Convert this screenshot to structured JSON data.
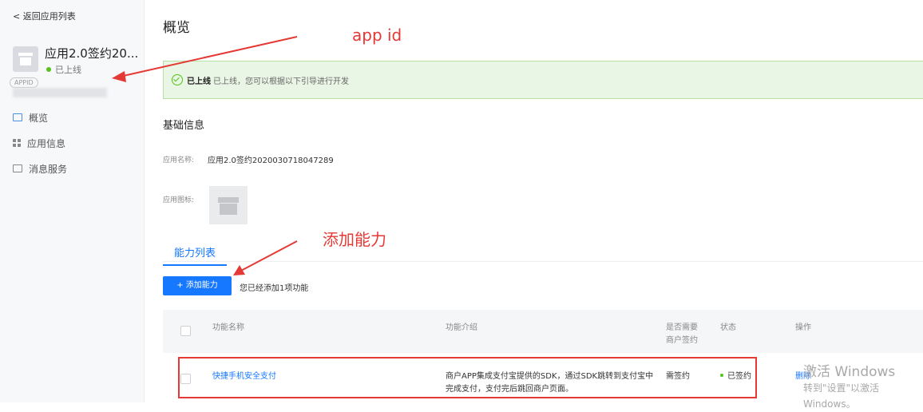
{
  "sidebar": {
    "back_label": "< 返回应用列表",
    "app_name": "应用2.0签约20...",
    "app_status": "已上线",
    "appid_badge": "APPID",
    "nav": [
      {
        "label": "概览",
        "icon": "overview-icon"
      },
      {
        "label": "应用信息",
        "icon": "grid-icon"
      },
      {
        "label": "消息服务",
        "icon": "message-icon"
      }
    ]
  },
  "main": {
    "title": "概览",
    "alert": {
      "status": "已上线",
      "message": "已上线，您可以根据以下引导进行开发"
    },
    "basic_section_title": "基础信息",
    "app_name_label": "应用名称:",
    "app_name_value": "应用2.0签约2020030718047289",
    "app_icon_label": "应用图标:",
    "tab_label": "能力列表",
    "add_button_label": "+ 添加能力",
    "add_note": "您已经添加1项功能",
    "table": {
      "headers": {
        "name": "功能名称",
        "desc": "功能介绍",
        "sign_line1": "是否需要",
        "sign_line2": "商户签约",
        "status": "状态",
        "ops": "操作"
      },
      "rows": [
        {
          "name": "快捷手机安全支付",
          "desc_line1": "商户APP集成支付宝提供的SDK，通过SDK跳转到支付宝中",
          "desc_line2": "完成支付，支付完后跳回商户页面。",
          "sign": "需签约",
          "status": "已签约",
          "op": "删除"
        }
      ]
    }
  },
  "annotations": {
    "appid": "app id",
    "add_capability": "添加能力",
    "color": "#e53935"
  },
  "watermark": {
    "line1": "激活 Windows",
    "line2": "转到\"设置\"以激活 Windows。"
  },
  "colors": {
    "primary": "#1677ff",
    "success": "#52c41a",
    "annotation": "#e53935"
  }
}
